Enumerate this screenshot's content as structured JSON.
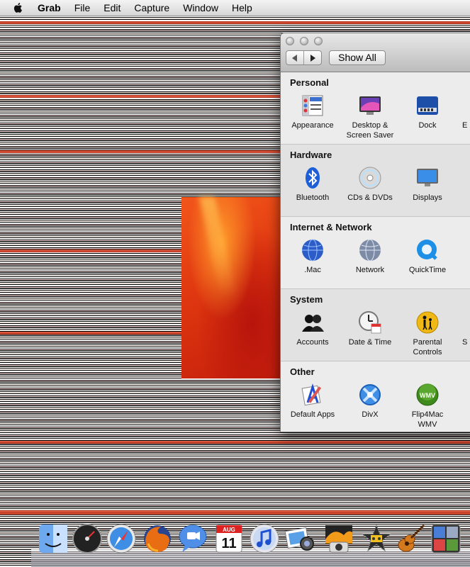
{
  "menubar": {
    "app": "Grab",
    "items": [
      "File",
      "Edit",
      "Capture",
      "Window",
      "Help"
    ]
  },
  "window": {
    "show_all": "Show All",
    "sections": {
      "personal": {
        "title": "Personal",
        "items": [
          "Appearance",
          "Desktop &\nScreen Saver",
          "Dock",
          "E"
        ]
      },
      "hardware": {
        "title": "Hardware",
        "items": [
          "Bluetooth",
          "CDs & DVDs",
          "Displays"
        ]
      },
      "internet": {
        "title": "Internet & Network",
        "items": [
          ".Mac",
          "Network",
          "QuickTime"
        ]
      },
      "system": {
        "title": "System",
        "items": [
          "Accounts",
          "Date & Time",
          "Parental\nControls",
          "S"
        ]
      },
      "other": {
        "title": "Other",
        "items": [
          "Default Apps",
          "DivX",
          "Flip4Mac\nWMV"
        ]
      }
    }
  },
  "dock": {
    "icons": [
      "finder-icon",
      "dashboard-icon",
      "safari-icon",
      "firefox-icon",
      "ichat-icon",
      "ical-icon",
      "itunes-icon",
      "iphoto-icon",
      "photo-booth-icon",
      "imovie-icon",
      "garageband-icon",
      "spaces-icon"
    ],
    "ical_day": "11",
    "ical_month": "AUG"
  },
  "colors": {
    "accent": "#2f6fd8",
    "desktop_red": "#d43a1e"
  }
}
